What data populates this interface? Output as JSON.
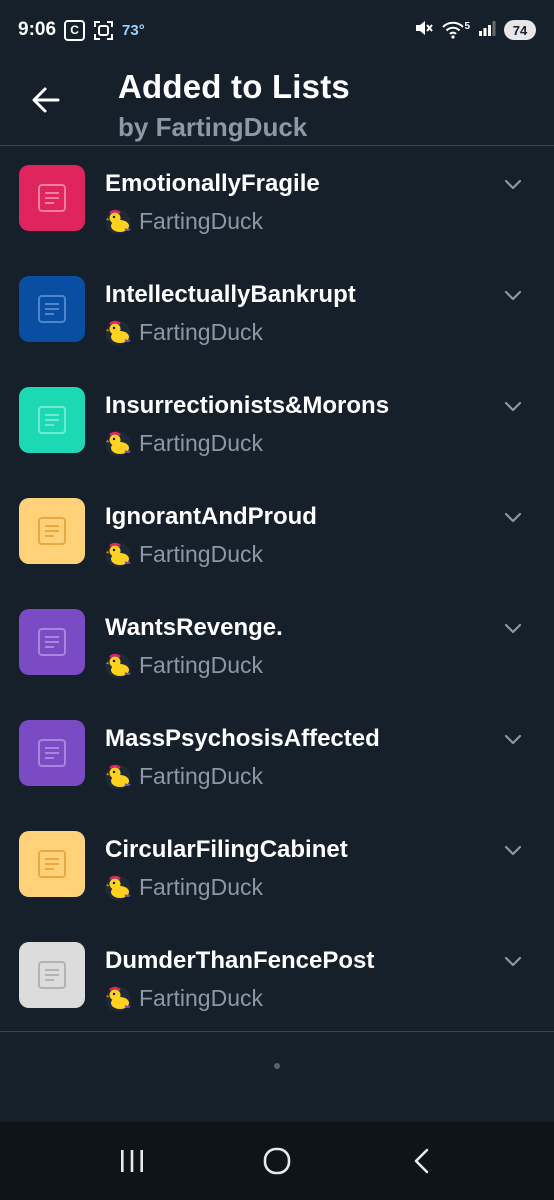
{
  "status_bar": {
    "time": "9:06",
    "c_badge": "C",
    "temperature": "73°",
    "wifi_label": "5",
    "battery": "74"
  },
  "header": {
    "title": "Added to Lists",
    "subtitle": "by FartingDuck",
    "back_icon": "arrow-left-icon"
  },
  "lists": [
    {
      "name": "EmotionallyFragile",
      "owner": "FartingDuck",
      "color": "#e0245e",
      "icon_color": "#f07e9f"
    },
    {
      "name": "IntellectuallyBankrupt",
      "owner": "FartingDuck",
      "color": "#0a4ea3",
      "icon_color": "#4f86c9"
    },
    {
      "name": "Insurrectionists&Morons",
      "owner": "FartingDuck",
      "color": "#1dd9b3",
      "icon_color": "#6fe9cf"
    },
    {
      "name": "IgnorantAndProud",
      "owner": "FartingDuck",
      "color": "#ffd27a",
      "icon_color": "#e9a940"
    },
    {
      "name": "WantsRevenge.",
      "owner": "FartingDuck",
      "color": "#7b4bc4",
      "icon_color": "#a886dc"
    },
    {
      "name": "MassPsychosisAffected",
      "owner": "FartingDuck",
      "color": "#7b4bc4",
      "icon_color": "#a886dc"
    },
    {
      "name": "CircularFilingCabinet",
      "owner": "FartingDuck",
      "color": "#ffd27a",
      "icon_color": "#e9a940"
    },
    {
      "name": "DumderThanFencePost",
      "owner": "FartingDuck",
      "color": "#dcdcdc",
      "icon_color": "#b3b3b3"
    }
  ],
  "nav": {
    "recents_icon": "recents-icon",
    "home_icon": "home-circle-icon",
    "back_icon": "nav-back-icon"
  }
}
